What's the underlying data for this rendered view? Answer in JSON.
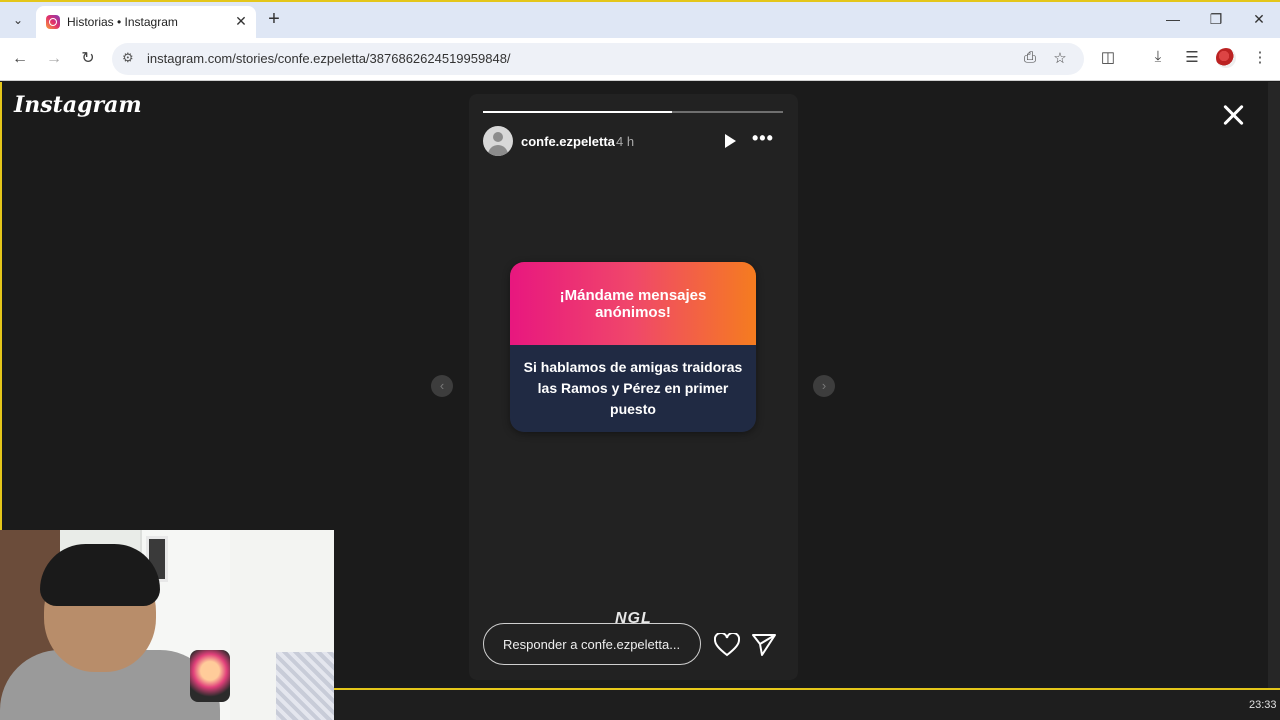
{
  "browser": {
    "tab_title": "Historias • Instagram",
    "url": "instagram.com/stories/confe.ezpeletta/3876862624519959848/"
  },
  "page": {
    "logo_text": "Instagram"
  },
  "story": {
    "username": "confe.ezpeletta",
    "time_ago": "4 h",
    "progress_fraction": 0.63,
    "question": "¡Mándame mensajes anónimos!",
    "answer": "Si hablamos de amigas traidoras las Ramos y Pérez en primer puesto",
    "brand": "NGL",
    "reply_placeholder": "Responder a confe.ezpeletta..."
  },
  "taskbar": {
    "clock": "23:33"
  },
  "icons": {
    "tab_favicon": "instagram-icon",
    "close_story": "close-icon",
    "play": "play-icon",
    "more": "more-icon",
    "heart": "heart-icon",
    "send": "send-icon"
  },
  "colors": {
    "card_gradient_start": "#e8177f",
    "card_gradient_end": "#f57c1f",
    "card_bottom": "#202a43",
    "accent_yellow": "#e4c61a"
  }
}
